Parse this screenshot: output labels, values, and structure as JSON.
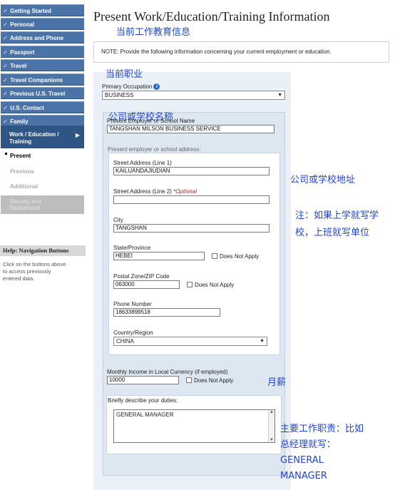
{
  "sidebar": {
    "items": [
      {
        "label": "Getting Started",
        "check": "✓"
      },
      {
        "label": "Personal",
        "check": "✓"
      },
      {
        "label": "Address and Phone",
        "check": "✓"
      },
      {
        "label": "Passport",
        "check": "✓"
      },
      {
        "label": "Travel",
        "check": "✓"
      },
      {
        "label": "Travel Companions",
        "check": "✓"
      },
      {
        "label": "Previous U.S. Travel",
        "check": "✓"
      },
      {
        "label": "U.S. Contact",
        "check": "✓"
      },
      {
        "label": "Family",
        "check": "✓"
      }
    ],
    "active": {
      "line1": "Work / Education /",
      "line2": "Training",
      "arrow": "▶"
    },
    "subitems": [
      "Present",
      "Previous",
      "Additional"
    ],
    "disabled": {
      "line1": "Security and",
      "line2": "Background"
    },
    "help": {
      "title": "Help: Navigation Buttons",
      "line1": "Click on the buttons above",
      "line2": "to access previously",
      "line3": "entered data."
    }
  },
  "main": {
    "title": "Present Work/Education/Training Information",
    "note": "NOTE: Provide the following information concerning your current employment or education.",
    "primary_occupation": {
      "label": "Primary Occupation",
      "value": "BUSINESS",
      "info": "i"
    },
    "employer": {
      "label": "Present Employer or School Name",
      "value": "TANGSHAN MILSON BUSINESS SERVICE"
    },
    "address_heading": "Present employer or school address:",
    "street1": {
      "label": "Street Address (Line 1)",
      "value": "KAILUANDAJIUDIAN"
    },
    "street2": {
      "label": "Street Address (Line 2)",
      "optional": "*Optional",
      "value": ""
    },
    "city": {
      "label": "City",
      "value": "TANGSHAN"
    },
    "state": {
      "label": "State/Province",
      "value": "HEBEI",
      "dna": "Does Not Apply"
    },
    "postal": {
      "label": "Postal Zone/ZIP Code",
      "value": "063000",
      "dna": "Does Not Apply"
    },
    "phone": {
      "label": "Phone Number",
      "value": "18633899518"
    },
    "country": {
      "label": "Country/Region",
      "value": "CHINA"
    },
    "income": {
      "label": "Monthly Income in Local Currency (if employed)",
      "value": "10000",
      "dna": "Does Not Apply"
    },
    "duties": {
      "label": "Briefly describe your duties:",
      "value": "GENERAL MANAGER"
    }
  },
  "annotations": {
    "title_note": "当前工作教育信息",
    "occupation_note": "当前职业",
    "employer_note": "公司或学校名称",
    "address_note": "公司或学校地址",
    "tip_line1": "注：如果上学就写学",
    "tip_line2": "校，上班就写单位",
    "income_note": "月薪",
    "duties_line1": "主要工作职责：比如",
    "duties_line2": "总经理就写：",
    "duties_line3": "GENERAL",
    "duties_line4": "MANAGER"
  },
  "colors": {
    "nav": "#4a73a8",
    "nav_active": "#2f5584",
    "annotation": "#2244cc",
    "panel": "#eaf0f7"
  }
}
